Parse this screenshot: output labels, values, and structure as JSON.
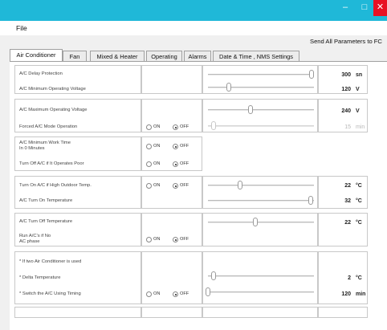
{
  "window": {
    "accent": "#1fb8d8",
    "close_color": "#e81123",
    "minimize_glyph": "–",
    "maximize_glyph": "□",
    "close_glyph": "✕"
  },
  "menu": {
    "file": "File"
  },
  "send_all_label": "Send All Parameters to FC",
  "tabs": [
    {
      "label": "Air Conditioner",
      "active": true
    },
    {
      "label": "Fan",
      "active": false
    },
    {
      "label": "Mixed & Heater",
      "active": false
    },
    {
      "label": "Operating",
      "active": false
    },
    {
      "label": "Alarms",
      "active": false
    },
    {
      "label": "Date & Time , NMS Settings",
      "active": false
    }
  ],
  "radio_labels": {
    "on": "ON",
    "off": "OFF"
  },
  "rows": [
    {
      "label": "A/C Delay Protection",
      "value": "300",
      "unit": "sn",
      "slider_level": 0.98,
      "enabled": true
    },
    {
      "label": "A/C Minimum Operating Voltage",
      "value": "120",
      "unit": "V",
      "slider_level": 0.2,
      "enabled": true
    },
    {
      "label": "A/C Maximum Operating Voltage",
      "value": "240",
      "unit": "V",
      "slider_level": 0.4,
      "enabled": true
    },
    {
      "label": "Forced A/C Mode Operation",
      "radio": "off",
      "value": "15",
      "unit": "min",
      "slider_level": 0.05,
      "enabled": false
    },
    {
      "label": "A/C Minimum Work Time\nIn 0 Minutes",
      "radio": "off"
    },
    {
      "label": "Turn Off A/C if It Operates Poor",
      "radio": "off"
    },
    {
      "label": "Turn On A/C if High Outdoor Temp.",
      "radio": "off",
      "value": "22",
      "unit": "°C",
      "slider_level": 0.3,
      "enabled": true
    },
    {
      "label": "A/C Turn On Temperature",
      "value": "32",
      "unit": "°C",
      "slider_level": 0.97,
      "enabled": true
    },
    {
      "label": "A/C Turn Off Temperature",
      "value": "22",
      "unit": "°C",
      "slider_level": 0.45,
      "enabled": true
    },
    {
      "label": "Run A/C's if No\nAC phase",
      "radio": "off"
    },
    {
      "label": "* If two Air Conditioner is used"
    },
    {
      "label": "* Delta Temperature",
      "value": "2",
      "unit": "°C",
      "slider_level": 0.05,
      "enabled": true
    },
    {
      "label": "* Switch the A/C Using Timing",
      "radio": "off",
      "value": "120",
      "unit": "min",
      "slider_level": 0.0,
      "enabled": true
    }
  ]
}
